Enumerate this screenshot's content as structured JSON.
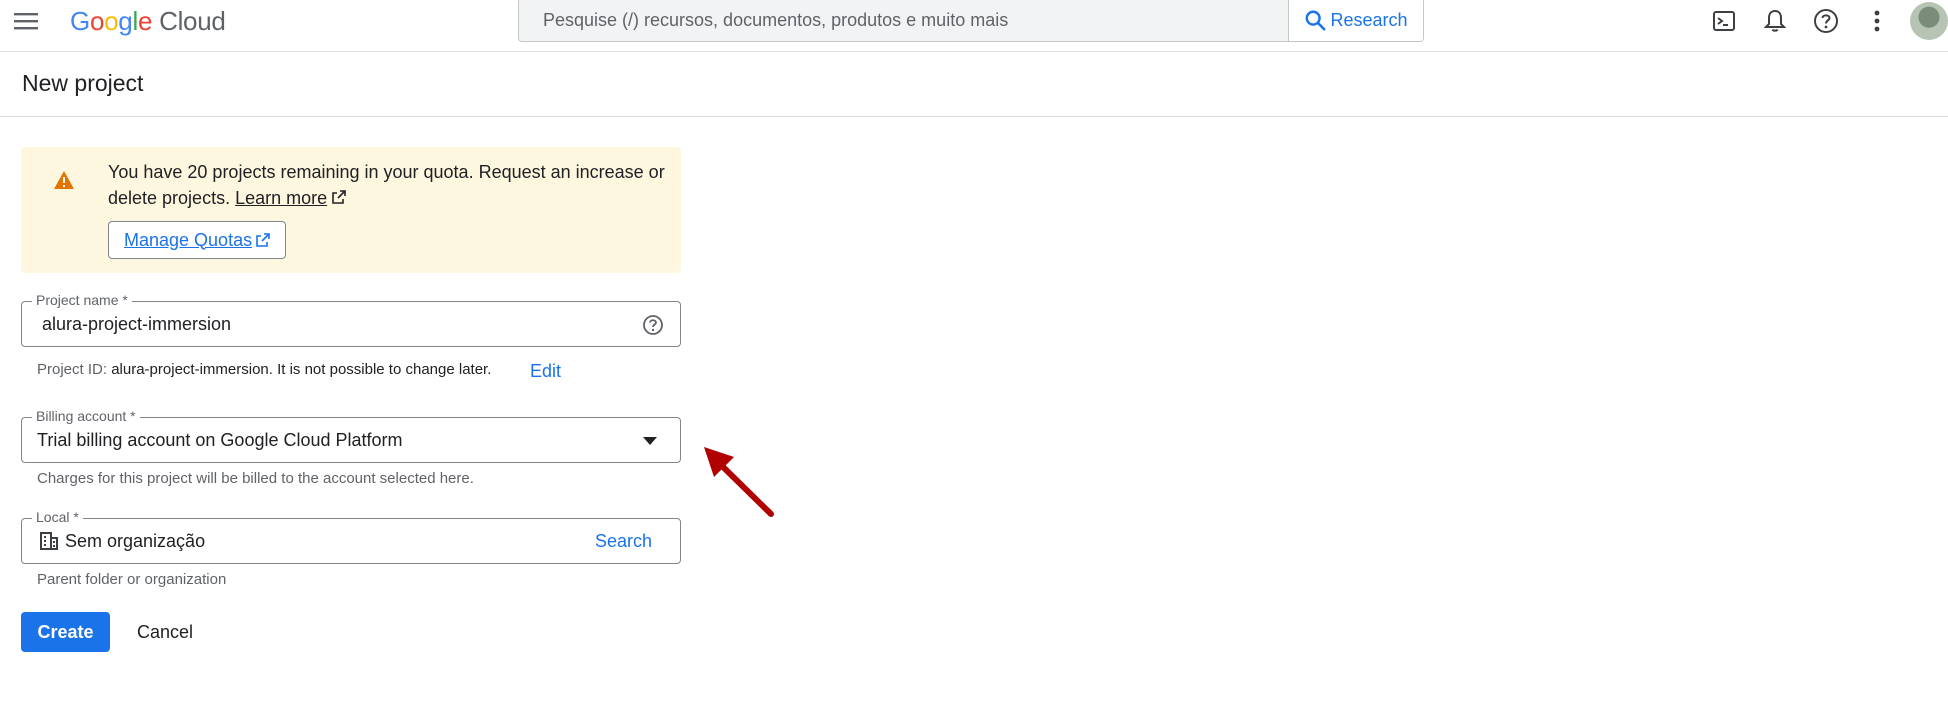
{
  "header": {
    "logo": {
      "g1": "G",
      "g2": "o",
      "g3": "o",
      "g4": "g",
      "g5": "l",
      "g6": "e",
      "product": "Cloud"
    },
    "search_placeholder": "Pesquise (/) recursos, documentos, produtos e muito mais",
    "research_label": "Research",
    "icons": [
      "terminal-icon",
      "bell-icon",
      "help-icon",
      "more-vert-icon"
    ]
  },
  "page": {
    "title": "New project"
  },
  "banner": {
    "text": "You have 20 projects remaining in your quota. Request an increase or delete projects.",
    "learn_more": "Learn more",
    "manage_quotas": "Manage Quotas"
  },
  "form": {
    "project_name": {
      "label": "Project name *",
      "value": "alura-project-immersion",
      "help_prefix": "Project ID:",
      "help_id": "alura-project-immersion",
      "help_suffix": ". It is not possible to change later.",
      "edit_label": "Edit"
    },
    "billing": {
      "label": "Billing account *",
      "value": "Trial billing account on Google Cloud Platform",
      "help": "Charges for this project will be billed to the account selected here."
    },
    "location": {
      "label": "Local *",
      "value": "Sem organização",
      "search_label": "Search",
      "help": "Parent folder or organization"
    }
  },
  "actions": {
    "create": "Create",
    "cancel": "Cancel"
  },
  "colors": {
    "accent": "#1a73e8",
    "warning": "#e37400",
    "banner_bg": "#fef7e0",
    "arrow": "#b00000"
  }
}
